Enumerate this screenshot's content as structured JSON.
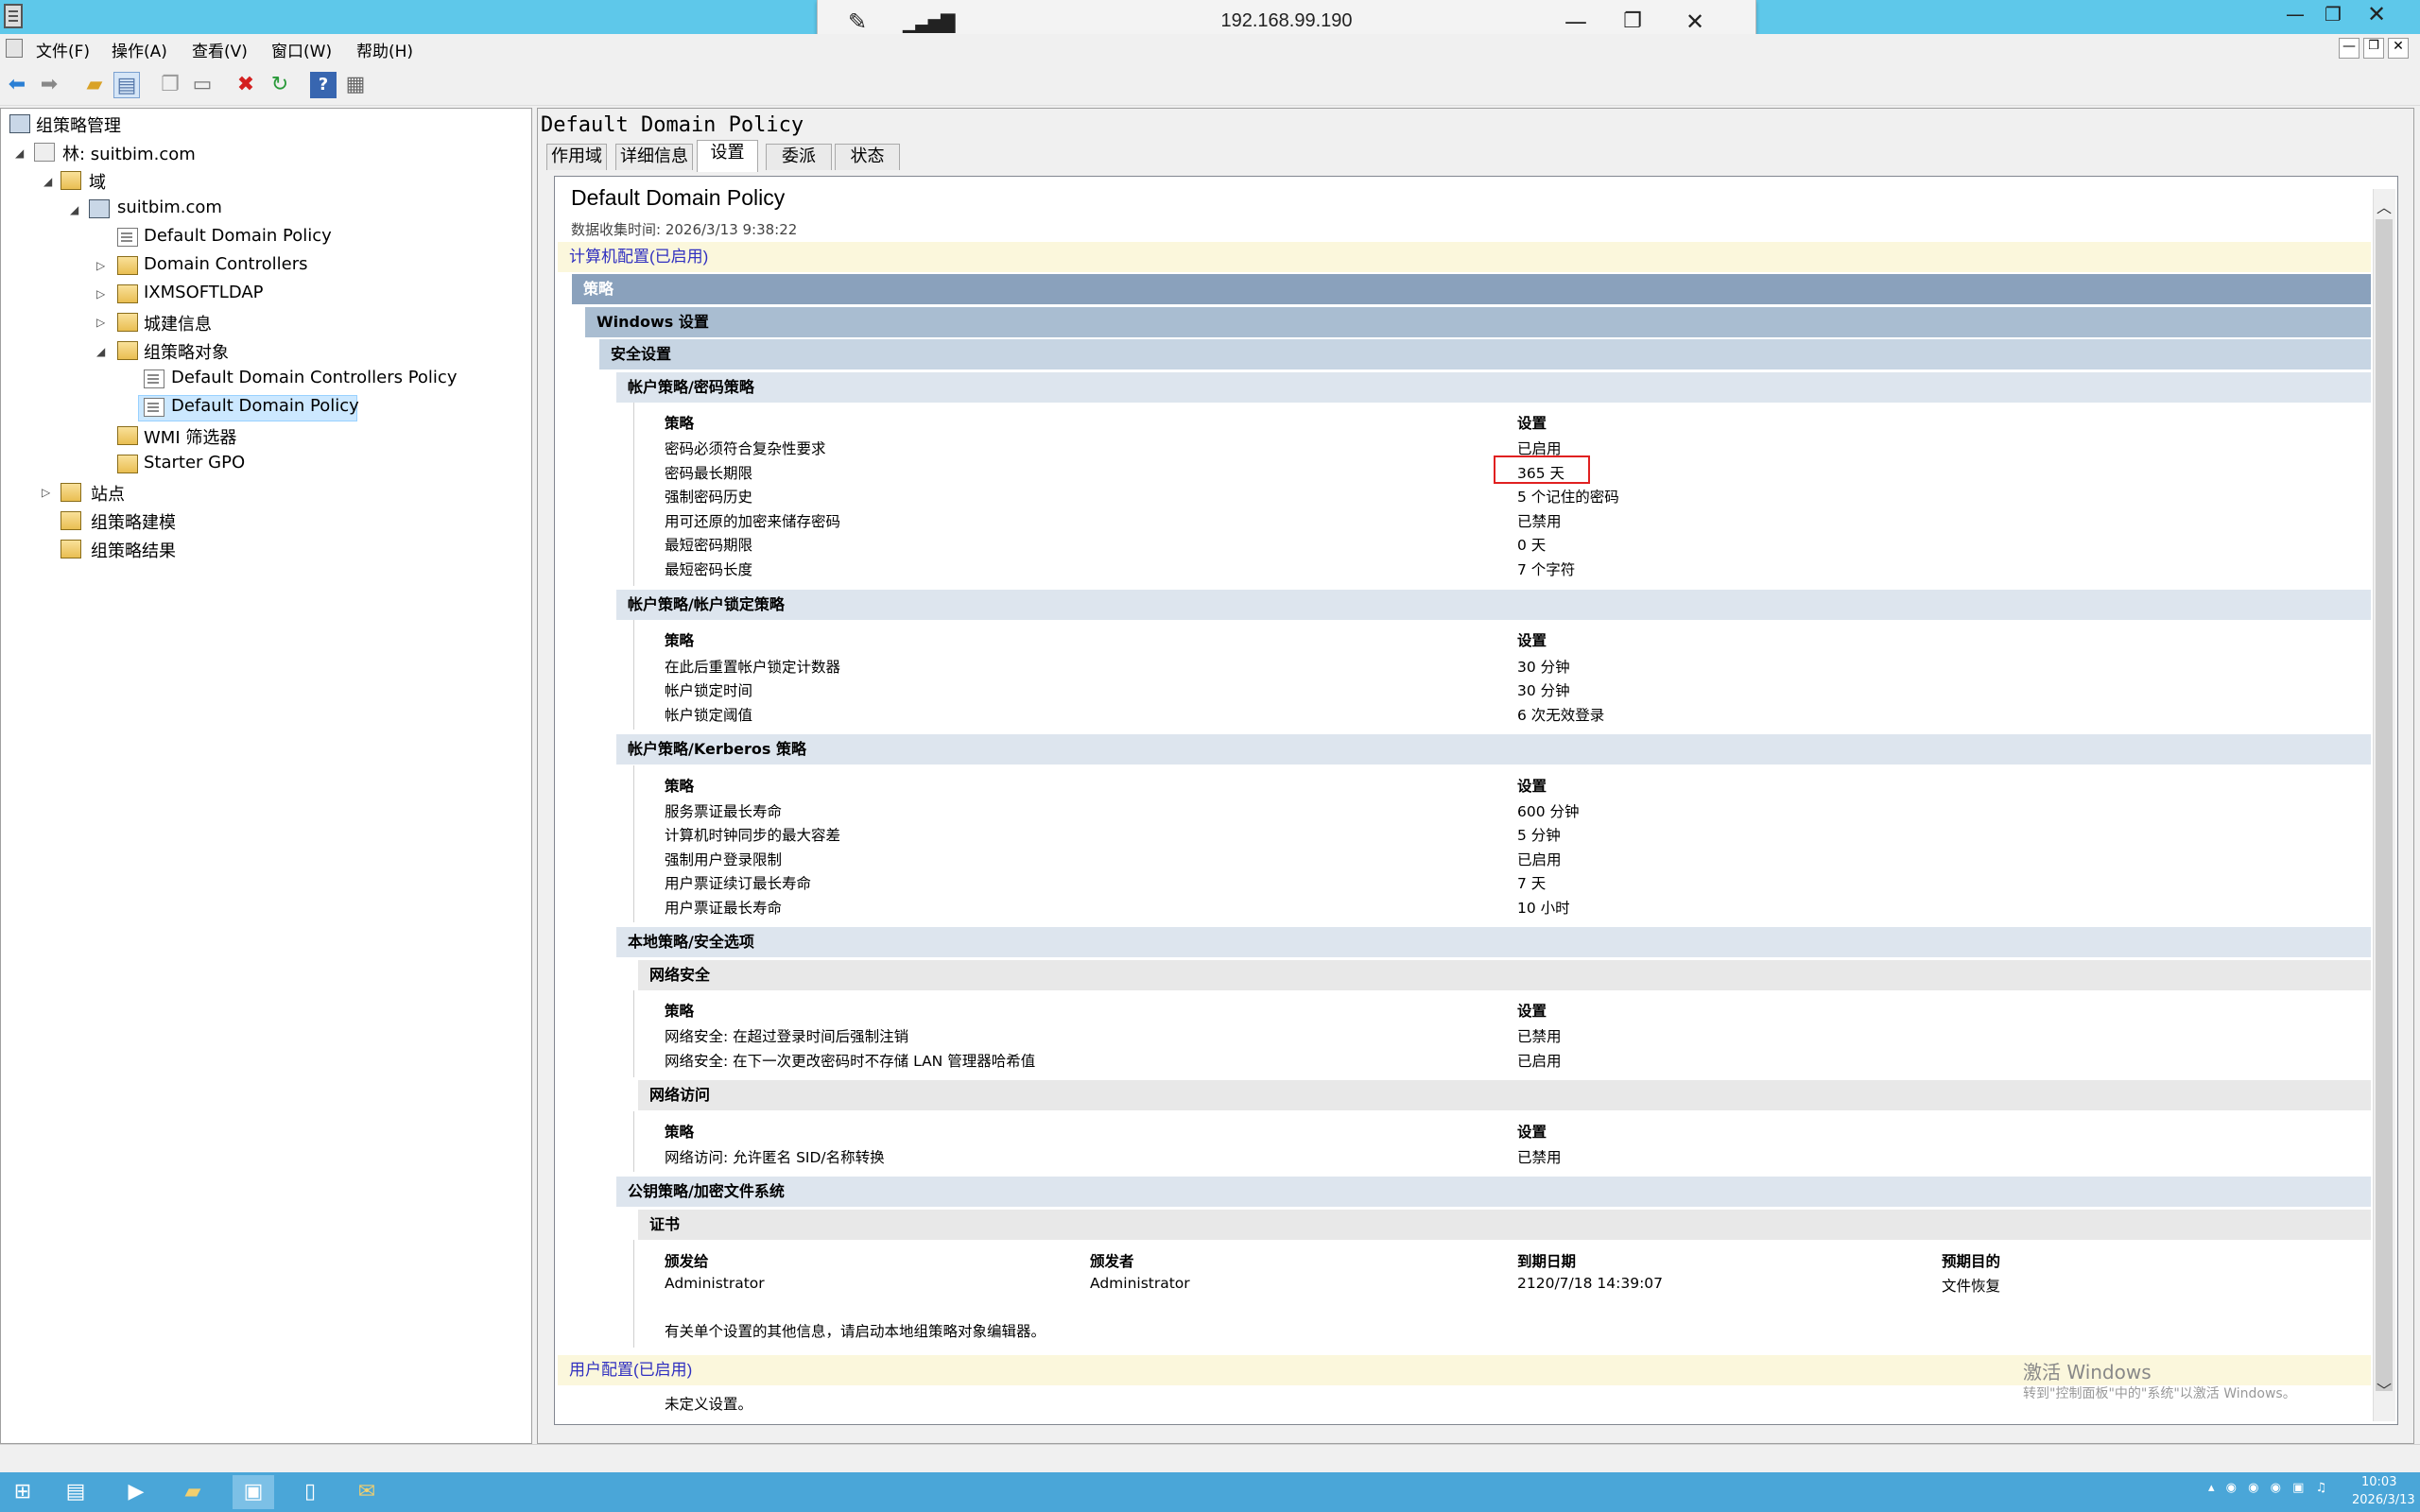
{
  "rdp": {
    "host": "192.168.99.190"
  },
  "menus": [
    "文件(F)",
    "操作(A)",
    "查看(V)",
    "窗口(W)",
    "帮助(H)"
  ],
  "tree": {
    "root": "组策略管理",
    "forest": "林: suitbim.com",
    "domains": "域",
    "domain": "suitbim.com",
    "ddp": "Default Domain Policy",
    "dc": "Domain Controllers",
    "ixm": "IXMSOFTLDAP",
    "city": "城建信息",
    "gpo": "组策略对象",
    "ddcp": "Default Domain Controllers Policy",
    "ddp_sel": "Default Domain Policy",
    "wmi": "WMI 筛选器",
    "starter": "Starter GPO",
    "sites": "站点",
    "modeling": "组策略建模",
    "results": "组策略结果"
  },
  "right": {
    "title": "Default Domain Policy",
    "tabs": [
      "作用域",
      "详细信息",
      "设置",
      "委派",
      "状态"
    ]
  },
  "report": {
    "title": "Default Domain Policy",
    "date": "数据收集时间: 2026/3/13 9:38:22",
    "computer_config": "计算机配置(已启用)",
    "policies": "策略",
    "windows_settings": "Windows 设置",
    "security_settings": "安全设置",
    "col_policy": "策略",
    "col_setting": "设置",
    "password": {
      "title": "帐户策略/密码策略",
      "rows": [
        {
          "name": "密码必须符合复杂性要求",
          "value": "已启用"
        },
        {
          "name": "密码最长期限",
          "value": "365 天"
        },
        {
          "name": "强制密码历史",
          "value": "5 个记住的密码"
        },
        {
          "name": "用可还原的加密来储存密码",
          "value": "已禁用"
        },
        {
          "name": "最短密码期限",
          "value": "0 天"
        },
        {
          "name": "最短密码长度",
          "value": "7 个字符"
        }
      ]
    },
    "lockout": {
      "title": "帐户策略/帐户锁定策略",
      "rows": [
        {
          "name": "在此后重置帐户锁定计数器",
          "value": "30 分钟"
        },
        {
          "name": "帐户锁定时间",
          "value": "30 分钟"
        },
        {
          "name": "帐户锁定阈值",
          "value": "6 次无效登录"
        }
      ]
    },
    "kerberos": {
      "title": "帐户策略/Kerberos 策略",
      "rows": [
        {
          "name": "服务票证最长寿命",
          "value": "600 分钟"
        },
        {
          "name": "计算机时钟同步的最大容差",
          "value": "5 分钟"
        },
        {
          "name": "强制用户登录限制",
          "value": "已启用"
        },
        {
          "name": "用户票证续订最长寿命",
          "value": "7 天"
        },
        {
          "name": "用户票证最长寿命",
          "value": "10 小时"
        }
      ]
    },
    "local": {
      "title": "本地策略/安全选项",
      "netsec": {
        "title": "网络安全",
        "rows": [
          {
            "name": "网络安全: 在超过登录时间后强制注销",
            "value": "已禁用"
          },
          {
            "name": "网络安全: 在下一次更改密码时不存储 LAN 管理器哈希值",
            "value": "已启用"
          }
        ]
      },
      "netaccess": {
        "title": "网络访问",
        "rows": [
          {
            "name": "网络访问: 允许匿名 SID/名称转换",
            "value": "已禁用"
          }
        ]
      }
    },
    "pki": {
      "title": "公钥策略/加密文件系统",
      "cert_title": "证书",
      "headers": [
        "颁发给",
        "颁发者",
        "到期日期",
        "预期目的"
      ],
      "row": [
        "Administrator",
        "Administrator",
        "2120/7/18 14:39:07",
        "文件恢复"
      ],
      "note": "有关单个设置的其他信息，请启动本地组策略对象编辑器。"
    },
    "user_config": "用户配置(已启用)",
    "undefined": "未定义设置。"
  },
  "watermark": {
    "line1": "激活 Windows",
    "line2": "转到\"控制面板\"中的\"系统\"以激活 Windows。"
  },
  "clock": {
    "time": "10:03",
    "date": "2026/3/13"
  },
  "icons": [
    "app-icon",
    "minimize-icon",
    "restore-icon",
    "close-icon",
    "pin-icon",
    "signal-icon",
    "back-icon",
    "forward-icon",
    "folder-up-icon",
    "show-hide-tree-icon",
    "copy-icon",
    "paste-icon",
    "delete-icon",
    "refresh-icon",
    "help-icon",
    "properties-icon",
    "start-icon",
    "server-manager-icon",
    "powershell-icon",
    "explorer-icon",
    "gpmc-icon",
    "notepad-icon",
    "certificate-icon"
  ]
}
